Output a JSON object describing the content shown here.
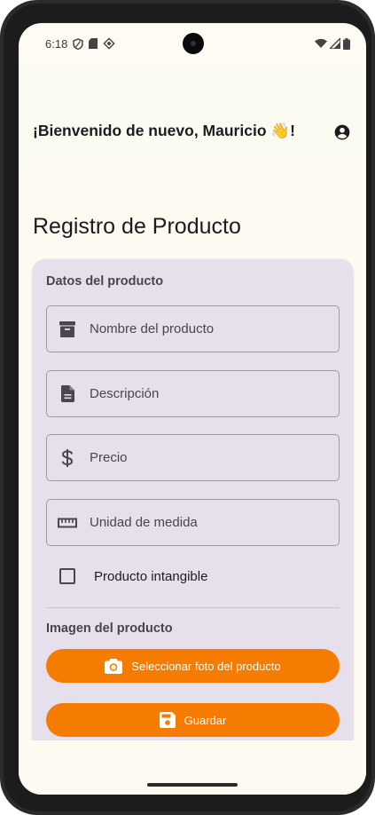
{
  "status_bar": {
    "time": "6:18",
    "left_icons": [
      "vpn-shield-icon",
      "sd-card-icon",
      "data-saver-icon"
    ],
    "right_icons": [
      "wifi-icon",
      "signal-icon",
      "battery-icon"
    ]
  },
  "header": {
    "welcome": "¡Bienvenido de nuevo, Mauricio 👋!",
    "account_icon": "account-circle-icon"
  },
  "page": {
    "title": "Registro de Producto"
  },
  "form": {
    "section_product": "Datos del producto",
    "fields": [
      {
        "icon": "archive-box-icon",
        "placeholder": "Nombre del producto"
      },
      {
        "icon": "document-icon",
        "placeholder": "Descripción"
      },
      {
        "icon": "dollar-icon",
        "placeholder": "Precio"
      },
      {
        "icon": "ruler-icon",
        "placeholder": "Unidad de medida"
      }
    ],
    "checkbox_label": "Producto intangible",
    "checkbox_checked": false,
    "section_image": "Imagen del producto",
    "select_photo_label": "Seleccionar foto del producto",
    "save_label": "Guardar"
  },
  "colors": {
    "accent": "#f57c00",
    "card": "#e6dfec",
    "background": "#fdfaf2"
  }
}
